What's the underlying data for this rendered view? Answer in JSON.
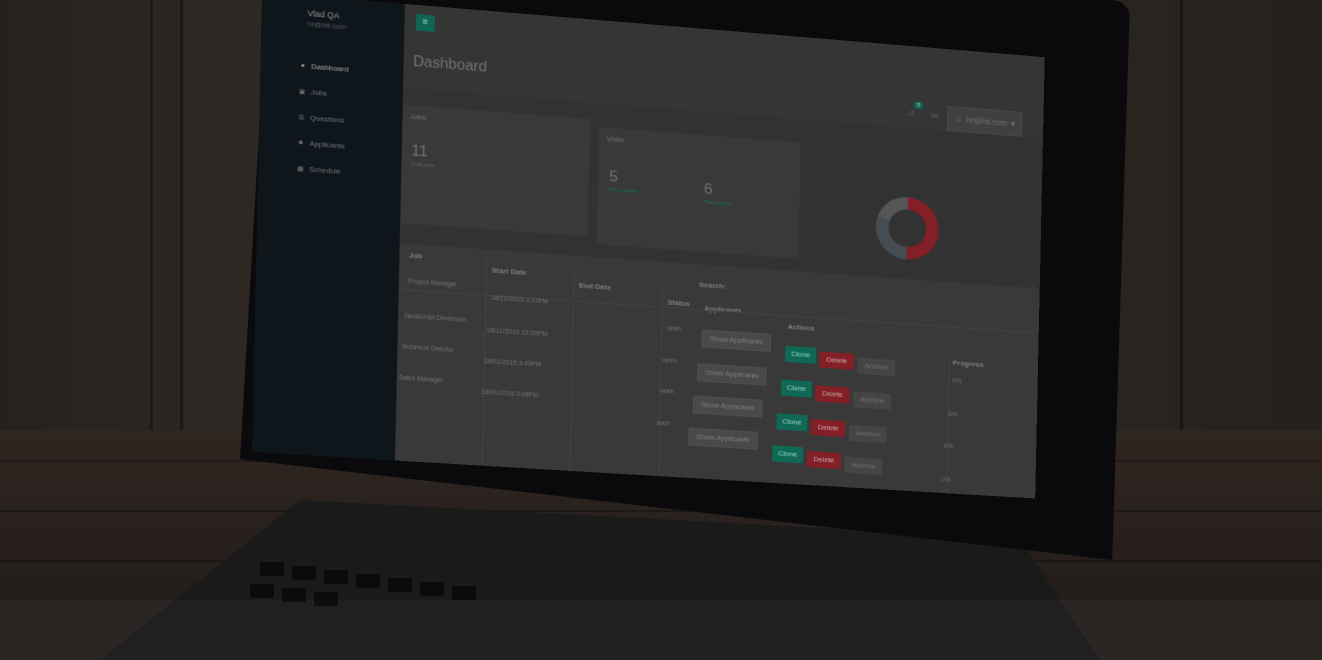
{
  "sidebar": {
    "user_name": "Vlad QA",
    "user_email": "hr@hit.com",
    "items": [
      {
        "label": "Dashboard",
        "icon": "dot-icon",
        "active": true
      },
      {
        "label": "Jobs",
        "icon": "briefcase-icon",
        "active": false
      },
      {
        "label": "Questions",
        "icon": "list-icon",
        "active": false
      },
      {
        "label": "Applicants",
        "icon": "users-icon",
        "active": false
      },
      {
        "label": "Schedule",
        "icon": "calendar-icon",
        "active": false
      }
    ]
  },
  "header": {
    "menu_icon": "hamburger-icon",
    "title": "Dashboard",
    "notification_count": "5",
    "user_label": "hr@hit.com"
  },
  "jobs_panel": {
    "title": "Jobs",
    "value": "11",
    "label": "Total jobs"
  },
  "visits_panel": {
    "title": "Visits",
    "prev_value": "5",
    "prev_label": "Prev month",
    "this_value": "6",
    "this_label": "This month"
  },
  "donut_chart": {
    "segments": [
      {
        "color": "#a0262f",
        "fraction": 0.5
      },
      {
        "color": "#555f66",
        "fraction": 0.3
      },
      {
        "color": "#6a6a6a",
        "fraction": 0.2
      }
    ]
  },
  "table": {
    "search_label": "Search:",
    "headers": {
      "job": "Job",
      "start_date": "Start Date",
      "end_date": "End Date",
      "status": "Status",
      "applicants": "Applicants",
      "actions": "Actions",
      "progress": "Progress"
    },
    "rows": [
      {
        "job": "Project Manager",
        "start": "18/12/2015 3:37PM",
        "end": "",
        "status": "open",
        "progress": "0%"
      },
      {
        "job": "JavaScript Developer",
        "start": "18/12/2015 12:00PM",
        "end": "",
        "status": "open",
        "progress": "0%"
      },
      {
        "job": "Technical Director",
        "start": "18/01/2016 3:49PM",
        "end": "",
        "status": "open",
        "progress": "0%"
      },
      {
        "job": "Sales Manager",
        "start": "18/01/2016 3:48PM",
        "end": "",
        "status": "open",
        "progress": "0%"
      }
    ],
    "show_label": "Show Applicants",
    "clone_label": "Clone",
    "delete_label": "Delete",
    "archive_label": "Archive"
  }
}
